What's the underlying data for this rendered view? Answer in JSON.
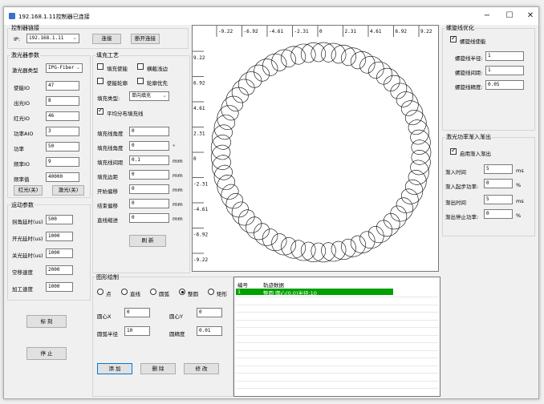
{
  "window": {
    "title": "192.168.1.11控制器已连接",
    "buttons": [
      "−",
      "☐",
      "✕"
    ]
  },
  "controller": {
    "group": "控制器链接",
    "ip_label": "IP:",
    "ip_value": "192.168.1.11",
    "connect": "连接",
    "disconnect": "断开连接"
  },
  "laser": {
    "group": "激光器参数",
    "type_label": "激光器类型",
    "type_value": "IPG-Fiber",
    "rows": [
      {
        "label": "使能IO",
        "value": "47"
      },
      {
        "label": "出光IO",
        "value": "8"
      },
      {
        "label": "红光IO",
        "value": "46"
      },
      {
        "label": "功率AIO",
        "value": "3"
      },
      {
        "label": "功率",
        "value": "50"
      },
      {
        "label": "频率IO",
        "value": "9"
      },
      {
        "label": "频率值",
        "value": "40000"
      }
    ],
    "red_off": "红光(关)",
    "laser_off": "激光(关)"
  },
  "motion": {
    "group": "运动参数",
    "rows": [
      {
        "label": "拐角延时(us)",
        "value": "500"
      },
      {
        "label": "开光延时(us)",
        "value": "1000"
      },
      {
        "label": "关光延时(us)",
        "value": "1000"
      },
      {
        "label": "空移速度",
        "value": "2000"
      },
      {
        "label": "加工速度",
        "value": "1000"
      }
    ]
  },
  "fill": {
    "group": "填充工艺",
    "fill_enable": "填充使能",
    "edge_scan": "横截浅边",
    "enable_outline": "使能轮廓",
    "outline_first": "轮廓优先",
    "type_label": "填充类型:",
    "type_value": "单向填充",
    "uniform": "平均分布填充线",
    "rows": [
      {
        "label": "填充线角度",
        "value": "0",
        "unit": ""
      },
      {
        "label": "填充线角度",
        "value": "0",
        "unit": "°"
      },
      {
        "label": "填充线间距",
        "value": "0.1",
        "unit": "mm"
      },
      {
        "label": "填充边距",
        "value": "0",
        "unit": "mm"
      },
      {
        "label": "开始偏移",
        "value": "0",
        "unit": "mm"
      },
      {
        "label": "结束偏移",
        "value": "0",
        "unit": "mm"
      },
      {
        "label": "直线缩进",
        "value": "0",
        "unit": "mm"
      }
    ],
    "refresh": "刷 新"
  },
  "drawing": {
    "group": "图形绘制",
    "shapes": [
      "点",
      "直线",
      "圆弧",
      "整圆",
      "矩形"
    ],
    "selected": 3,
    "cx_label": "圆心X",
    "cx_value": "0",
    "cy_label": "圆心Y",
    "cy_value": "0",
    "radius_label": "圆弧半径",
    "radius_value": "10",
    "precision_label": "圆精度",
    "precision_value": "0.01",
    "add": "添 加",
    "delete": "删 除",
    "modify": "修 改"
  },
  "actions": {
    "mark": "标 刻",
    "stop": "停 止"
  },
  "plot": {
    "top_ticks": [
      "-9.22",
      "-6.92",
      "-4.61",
      "-2.31",
      "0",
      "2.31",
      "4.61",
      "6.92",
      "9.22"
    ],
    "left_ticks": [
      "9.22",
      "6.92",
      "4.61",
      "2.31",
      "0",
      "-2.31",
      "-4.61",
      "-6.92",
      "-9.22"
    ]
  },
  "track": {
    "col_id": "编号",
    "col_data": "轨迹数据",
    "rows": [
      {
        "id": "1",
        "data": "整圆 圆心(0,0)半径:10"
      }
    ]
  },
  "spiral": {
    "group": "螺旋线优化",
    "enable": "螺旋线使能",
    "rows": [
      {
        "label": "螺旋线半径:",
        "value": "1"
      },
      {
        "label": "螺旋线间距:",
        "value": "1"
      },
      {
        "label": "螺旋线精度:",
        "value": "0.05"
      }
    ]
  },
  "power": {
    "group": "激光功率渐入渐出",
    "enable": "启用渐入渐出",
    "rows": [
      {
        "label": "渐入时间",
        "value": "5",
        "unit": "ms"
      },
      {
        "label": "渐入起步功率:",
        "value": "0",
        "unit": "%"
      },
      {
        "label": "渐出时间",
        "value": "5",
        "unit": "ms"
      },
      {
        "label": "渐出停止功率:",
        "value": "0",
        "unit": "%"
      }
    ]
  },
  "colors": {
    "selected_row": "#00a000"
  }
}
